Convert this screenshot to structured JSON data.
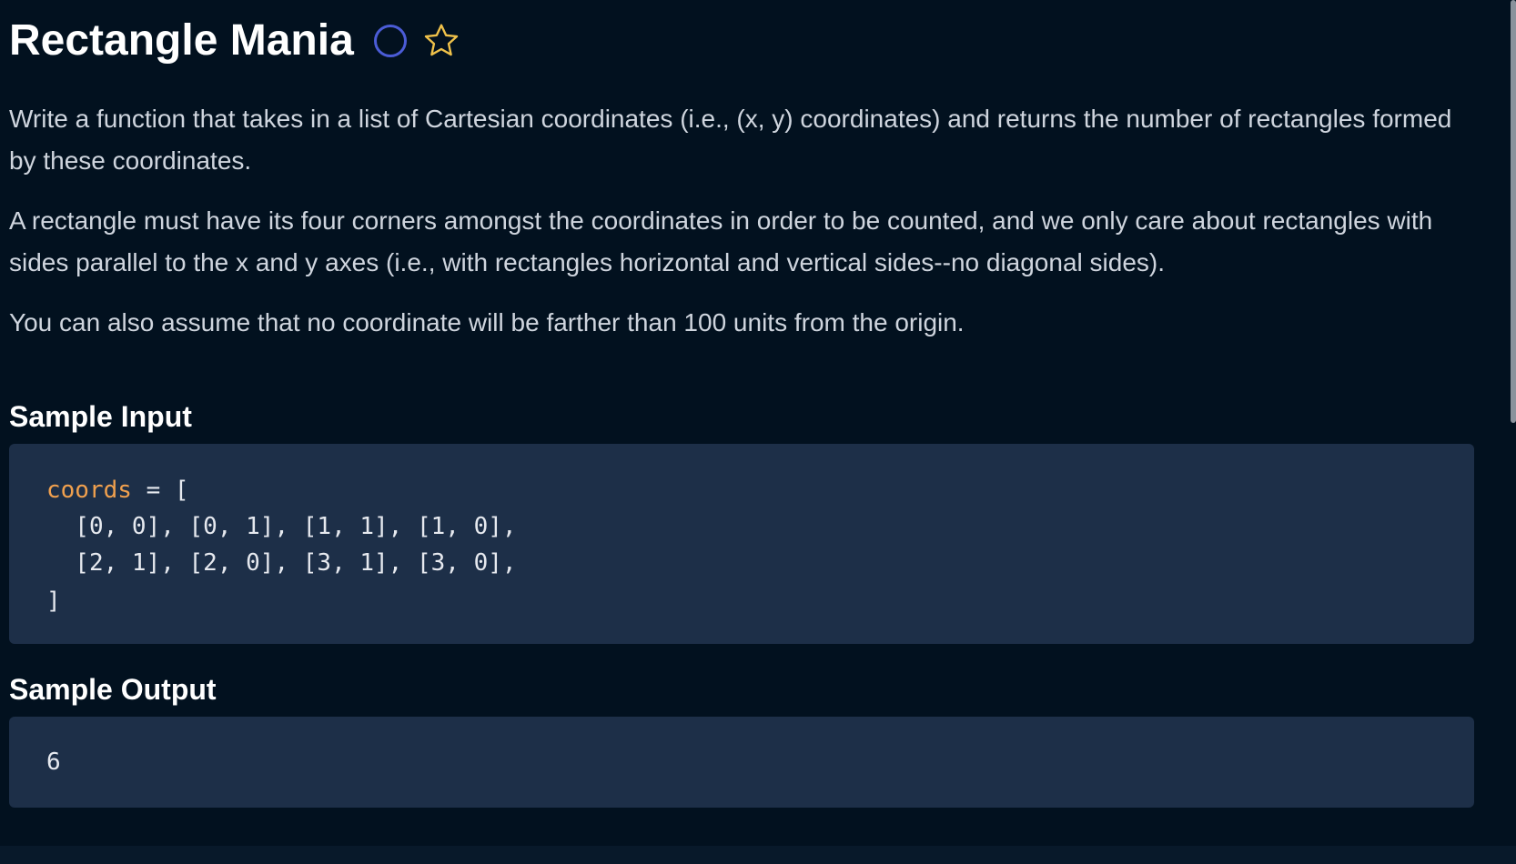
{
  "problem": {
    "title": "Rectangle Mania",
    "status_icon": "circle-outline",
    "favorite_icon": "star-outline",
    "colors": {
      "background": "#02111f",
      "code_background": "#1d2f48",
      "status_circle": "#4b5cd6",
      "star": "#f0c24a",
      "variable": "#f0a04e"
    }
  },
  "description": {
    "p1": "Write a function that takes in a list of Cartesian coordinates (i.e., (x, y) coordinates) and returns the number of rectangles formed by these coordinates.",
    "p2": "A rectangle must have its four corners amongst the coordinates in order to be counted, and we only care about rectangles with sides parallel to the x and y axes (i.e., with rectangles horizontal and vertical sides--no diagonal sides).",
    "p3": "You can also assume that no coordinate will be farther than 100 units from the origin."
  },
  "sample_input": {
    "heading": "Sample Input",
    "var_name": "coords",
    "assign": " = [",
    "line2": "  [0, 0], [0, 1], [1, 1], [1, 0],",
    "line3": "  [2, 1], [2, 0], [3, 1], [3, 0],",
    "line4": "]"
  },
  "sample_output": {
    "heading": "Sample Output",
    "value": "6"
  }
}
